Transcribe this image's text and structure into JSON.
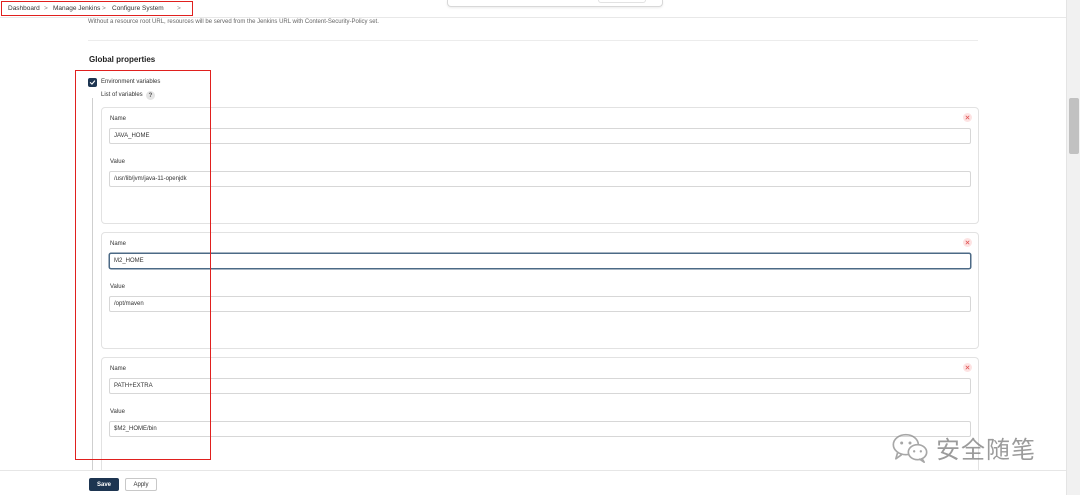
{
  "breadcrumb": {
    "items": [
      "Dashboard",
      "Manage Jenkins",
      "Configure System"
    ],
    "separator": ">"
  },
  "resource_hint": "Without a resource root URL, resources will be served from the Jenkins URL with Content-Security-Policy set.",
  "global_properties": {
    "title": "Global properties",
    "env_checkbox_label": "Environment variables",
    "env_checked": true,
    "list_label": "List of variables",
    "help_symbol": "?",
    "name_label": "Name",
    "value_label": "Value",
    "variables": [
      {
        "name": "JAVA_HOME",
        "value": "/usr/lib/jvm/java-11-openjdk"
      },
      {
        "name": "M2_HOME",
        "value": "/opt/maven"
      },
      {
        "name": "PATH+EXTRA",
        "value": "$M2_HOME/bin"
      }
    ]
  },
  "buttons": {
    "save": "Save",
    "apply": "Apply"
  },
  "watermark": {
    "text": "安全随笔"
  },
  "colors": {
    "primary": "#1d3551",
    "highlight_outline": "#e0201e",
    "delete_bg": "#fde3e3",
    "delete_x": "#e05252"
  },
  "icons": {
    "checkbox": "checkmark-icon",
    "help": "help-icon",
    "delete": "close-icon",
    "watermark": "wechat-icon"
  }
}
